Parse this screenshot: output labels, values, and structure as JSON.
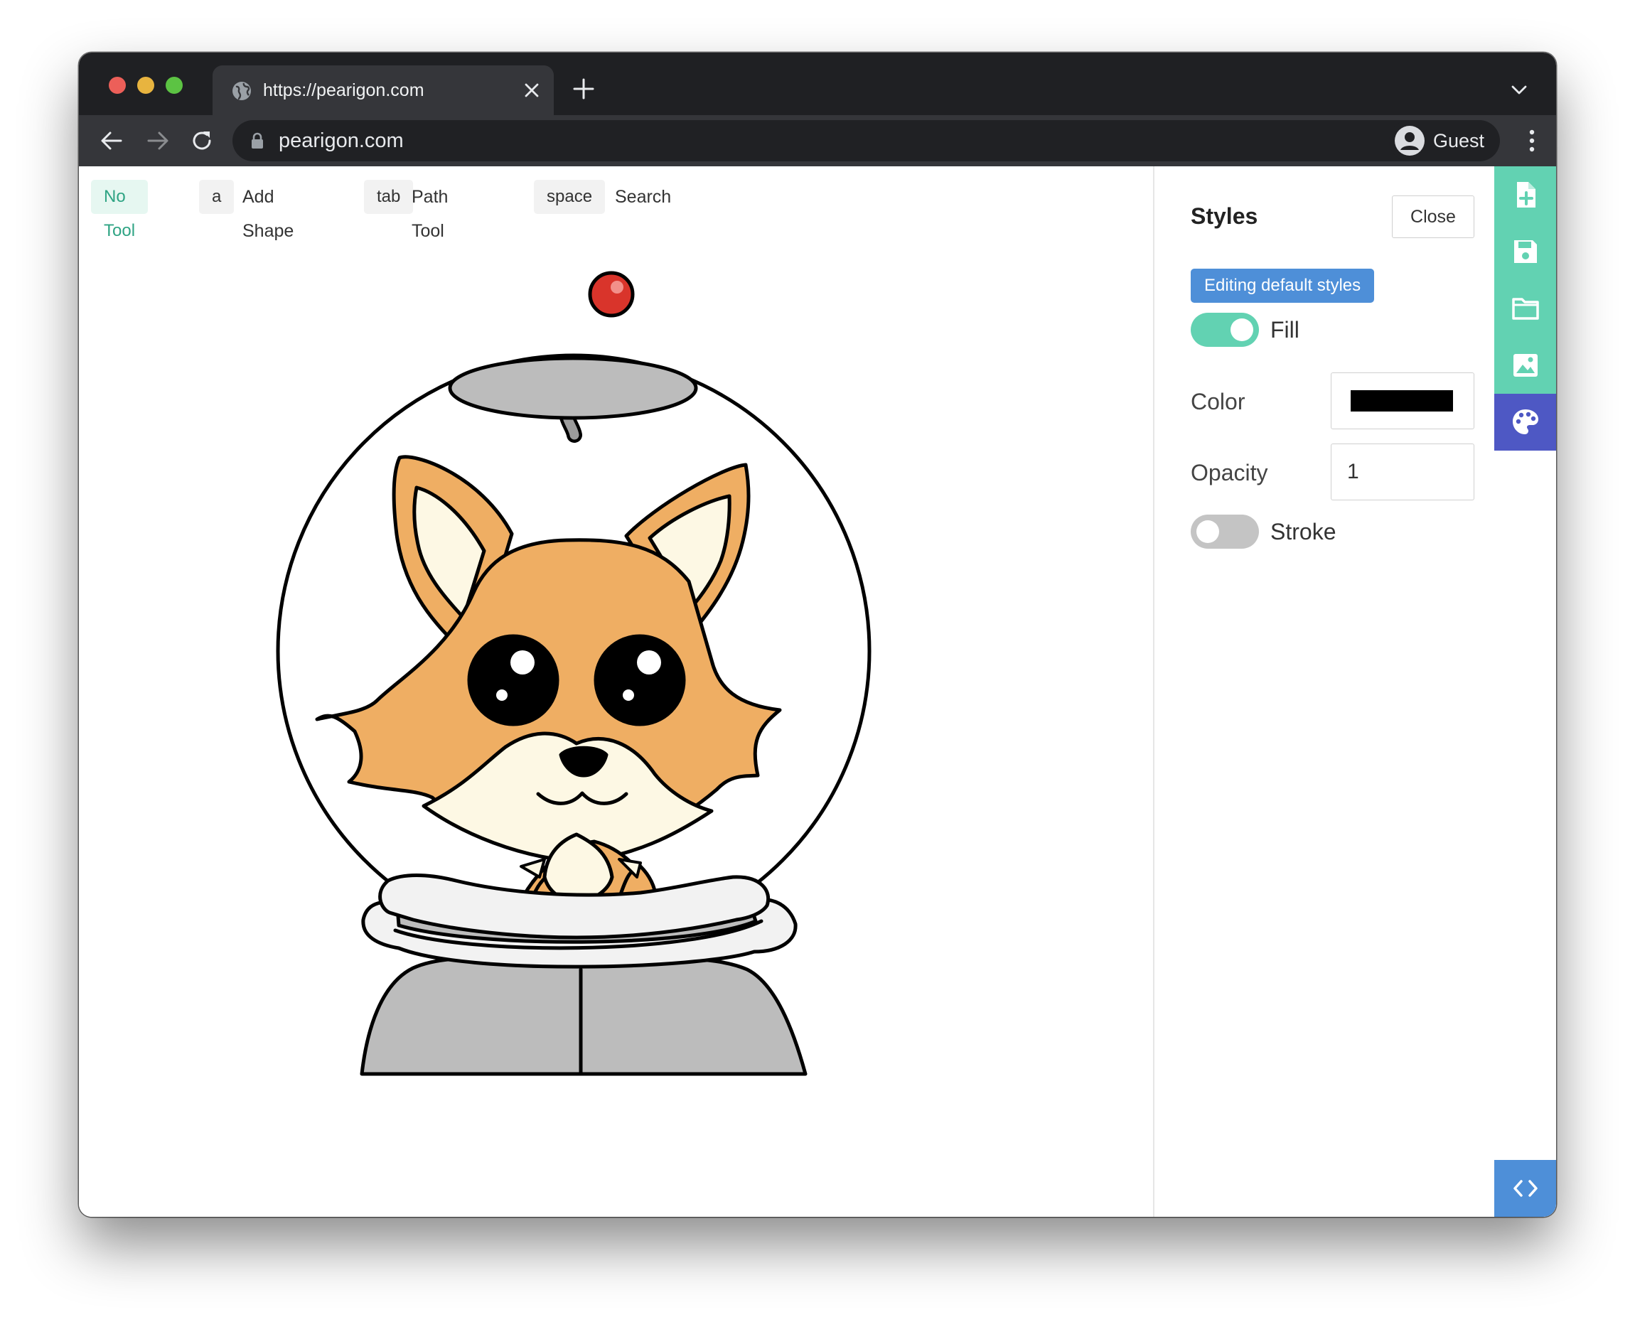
{
  "browser": {
    "tab_title": "https://pearigon.com",
    "url": "pearigon.com",
    "profile_name": "Guest"
  },
  "hints": [
    {
      "key": "No Tool",
      "label": ""
    },
    {
      "key": "a",
      "label": "Add Shape"
    },
    {
      "key": "tab",
      "label": "Path Tool"
    },
    {
      "key": "space",
      "label": "Search"
    }
  ],
  "styles_panel": {
    "title": "Styles",
    "close_label": "Close",
    "mode_badge": "Editing default styles",
    "fill": {
      "label": "Fill",
      "enabled": true
    },
    "color": {
      "label": "Color",
      "value": "#000000"
    },
    "opacity": {
      "label": "Opacity",
      "value": "1"
    },
    "stroke": {
      "label": "Stroke",
      "enabled": false
    }
  },
  "sidebar": {
    "buttons": [
      "new-file-icon",
      "save-icon",
      "folder-icon",
      "image-icon",
      "palette-icon"
    ],
    "active": "palette-icon",
    "bottom_button": "code-icon"
  },
  "colors": {
    "accent_green": "#62d2b2",
    "accent_indigo": "#4e58c4",
    "accent_blue": "#4e8fd8",
    "fox_orange": "#efae63",
    "fox_cream": "#fdf8e4",
    "helmet_gray": "#bcbcbc",
    "antenna_red": "#d9342b"
  }
}
